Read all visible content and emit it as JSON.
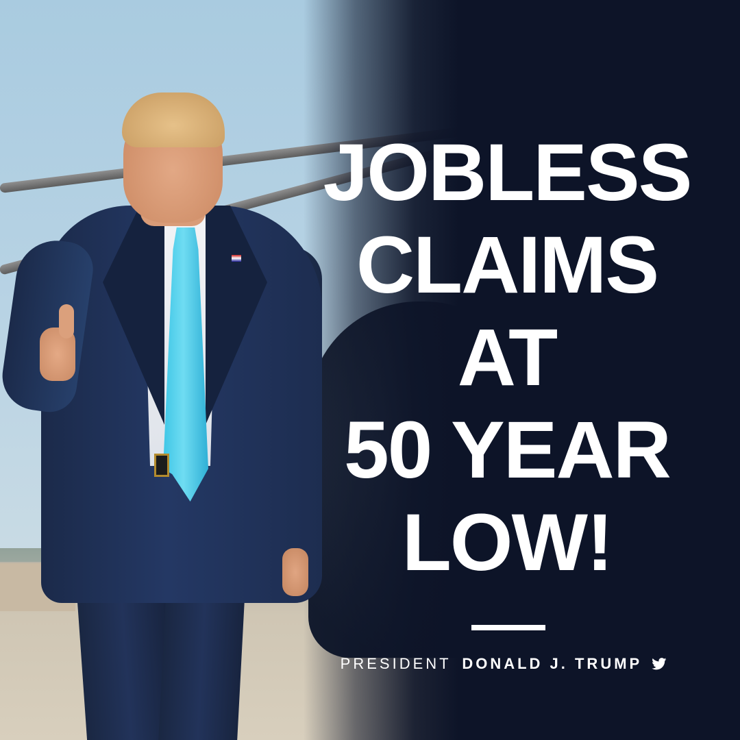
{
  "headline": {
    "lines": [
      "JOBLESS",
      "CLAIMS",
      "AT",
      "50 YEAR",
      "LOW!"
    ]
  },
  "byline": {
    "prefix": "PRESIDENT",
    "name": "DONALD J. TRUMP",
    "icon": "twitter-bird-icon"
  },
  "colors": {
    "panel": "#0d1428",
    "text": "#ffffff",
    "tie": "#3ec6e6",
    "sky": "#b8d3e4"
  }
}
